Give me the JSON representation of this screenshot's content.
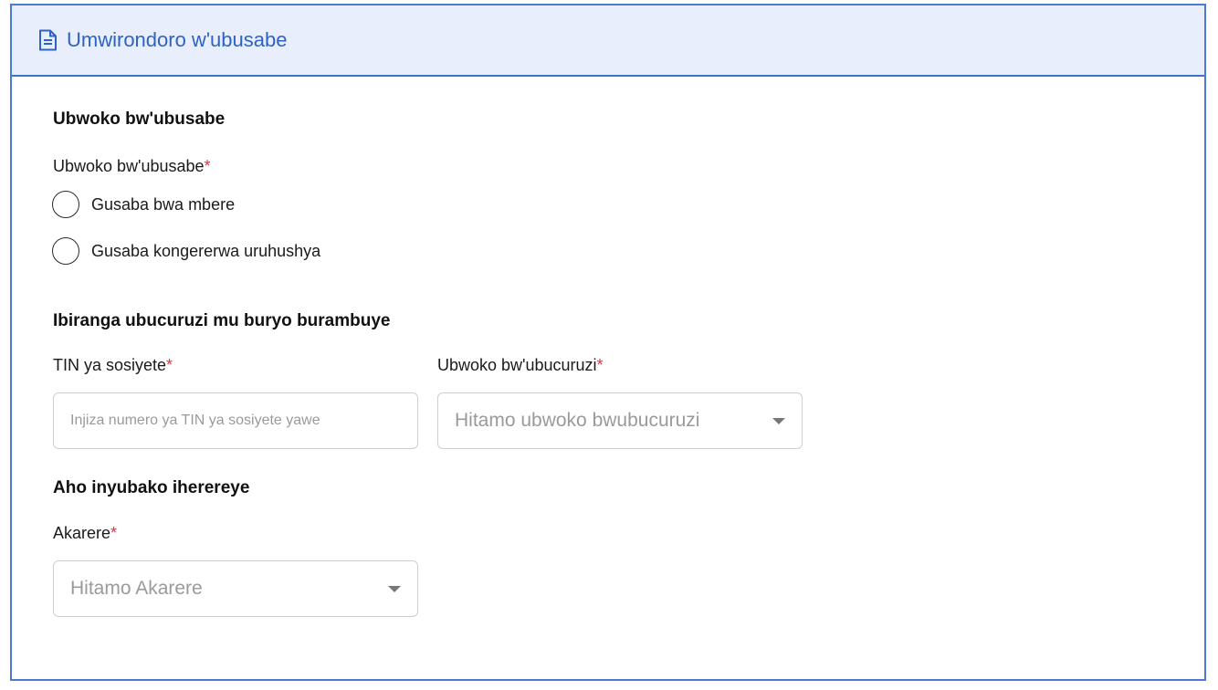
{
  "header": {
    "icon": "document-icon",
    "title": "Umwirondoro w'ubusabe",
    "accent_color": "#2e62c4",
    "background_color": "#e8eefb"
  },
  "section_request_type": {
    "title": "Ubwoko bw'ubusabe",
    "field_label": "Ubwoko bw'ubusabe",
    "required_mark": "*",
    "options": [
      {
        "label": "Gusaba bwa mbere",
        "selected": false
      },
      {
        "label": "Gusaba kongererwa uruhushya",
        "selected": false
      }
    ]
  },
  "section_business": {
    "title": "Ibiranga ubucuruzi mu buryo burambuye",
    "tin_label": "TIN ya sosiyete",
    "tin_required_mark": "*",
    "tin_placeholder": "Injiza numero ya TIN ya sosiyete yawe",
    "type_label": "Ubwoko bw'ubucuruzi",
    "type_required_mark": "*",
    "type_placeholder": "Hitamo ubwoko bwubucuruzi"
  },
  "section_location": {
    "title": "Aho inyubako iherereye",
    "district_label": "Akarere",
    "district_required_mark": "*",
    "district_placeholder": "Hitamo Akarere"
  },
  "colors": {
    "required": "#e0323e",
    "border": "#4a7bd0",
    "placeholder": "#9a9a9a"
  }
}
